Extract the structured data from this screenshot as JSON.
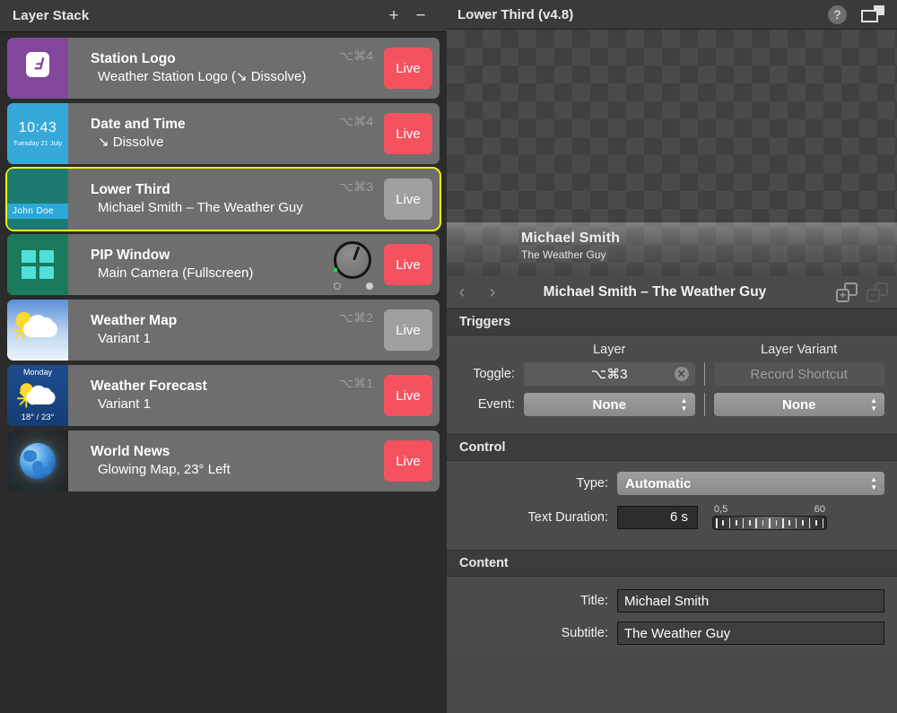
{
  "left_panel": {
    "title": "Layer Stack",
    "add_label": "+",
    "remove_label": "−",
    "layers": [
      {
        "name": "Station Logo",
        "subtitle": "Weather Station Logo (↘ Dissolve)",
        "shortcut": "⌥⌘4",
        "live_label": "Live",
        "live": true,
        "selected": false,
        "thumb": "station-logo",
        "thumb_mark": "Ⅎ"
      },
      {
        "name": "Date and Time",
        "subtitle": "↘ Dissolve",
        "shortcut": "⌥⌘4",
        "live_label": "Live",
        "live": true,
        "selected": false,
        "thumb": "date-time",
        "thumb_time": "10:43",
        "thumb_date": "Tuesday 21 July"
      },
      {
        "name": "Lower Third",
        "subtitle": "Michael Smith – The Weather Guy",
        "shortcut": "⌥⌘3",
        "live_label": "Live",
        "live": false,
        "selected": true,
        "thumb": "lower-third",
        "thumb_band": "John Doe"
      },
      {
        "name": "PIP Window",
        "subtitle": "Main Camera (Fullscreen)",
        "shortcut": "",
        "knob": true,
        "live_label": "Live",
        "live": true,
        "selected": false,
        "thumb": "pip-window"
      },
      {
        "name": "Weather Map",
        "subtitle": "Variant 1",
        "shortcut": "⌥⌘2",
        "live_label": "Live",
        "live": false,
        "selected": false,
        "thumb": "weather-map"
      },
      {
        "name": "Weather Forecast",
        "subtitle": "Variant 1",
        "shortcut": "⌥⌘1",
        "live_label": "Live",
        "live": true,
        "selected": false,
        "thumb": "weather-forecast",
        "thumb_day": "Monday",
        "thumb_temp": "18° / 23°"
      },
      {
        "name": "World News",
        "subtitle": "Glowing Map, 23° Left",
        "shortcut": "",
        "live_label": "Live",
        "live": true,
        "selected": false,
        "thumb": "world-news"
      }
    ]
  },
  "right_panel": {
    "title": "Lower Third (v4.8)",
    "help_label": "?",
    "preview": {
      "title": "Michael Smith",
      "subtitle": "The Weather Guy"
    },
    "variant_bar": {
      "prev": "‹",
      "next": "›",
      "label": "Michael Smith – The Weather Guy",
      "add_icon_label": "+",
      "remove_icon_label": "−"
    },
    "triggers": {
      "header": "Triggers",
      "col_layer": "Layer",
      "col_variant": "Layer Variant",
      "toggle_label": "Toggle:",
      "toggle_layer_value": "⌥⌘3",
      "toggle_variant_placeholder": "Record Shortcut",
      "clear_label": "✕",
      "event_label": "Event:",
      "event_layer_value": "None",
      "event_variant_value": "None"
    },
    "control": {
      "header": "Control",
      "type_label": "Type:",
      "type_value": "Automatic",
      "duration_label": "Text Duration:",
      "duration_value": "6 s",
      "slider_min": "0,5",
      "slider_max": "60"
    },
    "content": {
      "header": "Content",
      "title_label": "Title:",
      "title_value": "Michael Smith",
      "subtitle_label": "Subtitle:",
      "subtitle_value": "The Weather Guy"
    }
  },
  "colors": {
    "live_on": "#f4525f",
    "live_off": "#a0a0a0",
    "selection": "#f2f213",
    "panel_bg": "#4b4b4b",
    "list_bg": "#2b2b2b"
  }
}
